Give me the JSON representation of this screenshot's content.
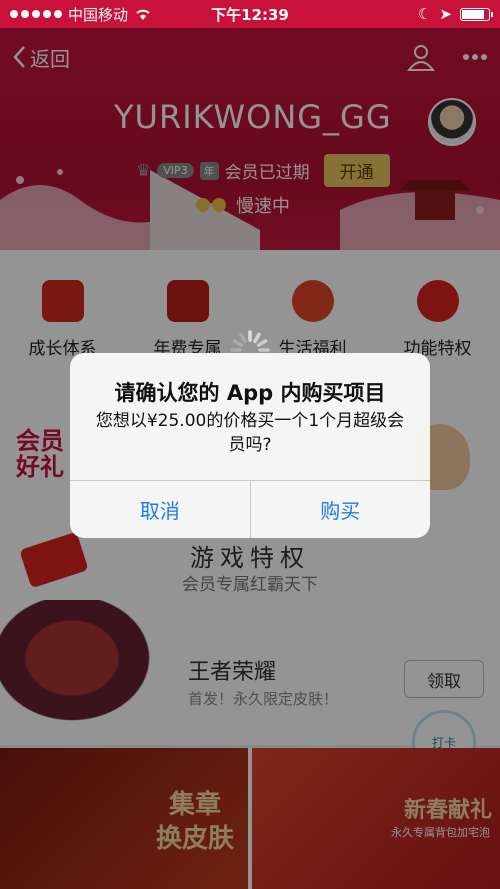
{
  "status_bar": {
    "carrier": "中国移动",
    "time": "下午12:39"
  },
  "nav": {
    "back_label": "返回",
    "icons": [
      "person-icon",
      "more-icon"
    ]
  },
  "profile": {
    "username": "YURIKWONG_GG",
    "vip_level": "VIP3",
    "year_badge": "年",
    "membership_status": "会员已过期",
    "open_button": "开通",
    "speed_status": "慢速中"
  },
  "features": [
    {
      "label": "成长体系"
    },
    {
      "label": "年费专属"
    },
    {
      "label": "生活福利"
    },
    {
      "label": "功能特权"
    }
  ],
  "promo": {
    "gift_line1": "会员",
    "gift_line2": "好礼"
  },
  "games_section": {
    "title": "游戏特权",
    "subtitle": "会员专属红霸天下"
  },
  "game_item": {
    "name": "王者荣耀",
    "description": "首发！永久限定皮肤！",
    "claim_button": "领取",
    "checkin_label": "打卡"
  },
  "banners": [
    {
      "text_line1": "集章",
      "text_line2": "换皮肤"
    },
    {
      "text": "新春献礼",
      "subtext": "永久专属背包加宅泡"
    }
  ],
  "alert": {
    "title": "请确认您的 App 内购买项目",
    "message": "您想以¥25.00的价格买一个1个月超级会员吗?",
    "cancel_button": "取消",
    "buy_button": "购买"
  },
  "colors": {
    "brand_red": "#c8123a",
    "ios_blue": "#1a7cf0",
    "gold": "#e6c45c"
  }
}
